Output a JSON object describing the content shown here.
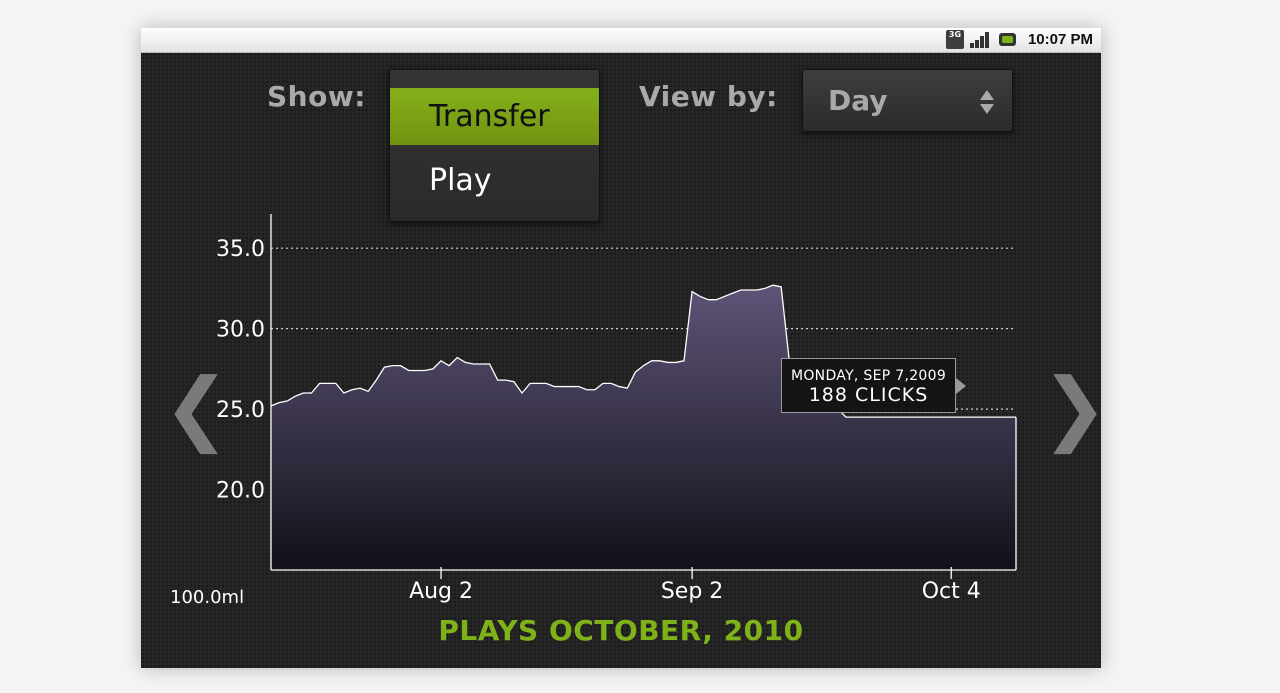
{
  "status_bar": {
    "network": "3G",
    "time": "10:07 PM"
  },
  "controls": {
    "show_label": "Show:",
    "show_options": [
      "Transfer",
      "Play"
    ],
    "show_selected": "Transfer",
    "viewby_label": "View by:",
    "viewby_value": "Day"
  },
  "navigation": {
    "prev": "❮",
    "next": "❯"
  },
  "unit_label": "100.0ml",
  "tooltip": {
    "date": "MONDAY, SEP 7,2009",
    "value": "188 CLICKS"
  },
  "colors": {
    "accent": "#7fb219",
    "selected_item": "#86b01a",
    "area_top": "#5e5478",
    "area_bottom": "#121018"
  },
  "chart_data": {
    "type": "area",
    "title": "PLAYS OCTOBER, 2010",
    "xlabel": "",
    "ylabel": "",
    "yticks": [
      "35.0",
      "30.0",
      "25.0",
      "20.0"
    ],
    "xticks": [
      "Aug 2",
      "Sep 2",
      "Oct 4"
    ],
    "ylim": [
      15,
      37
    ],
    "grid": true,
    "x": [
      "Jul 12",
      "Jul 13",
      "Jul 14",
      "Jul 15",
      "Jul 16",
      "Jul 17",
      "Jul 18",
      "Jul 19",
      "Jul 20",
      "Jul 21",
      "Jul 22",
      "Jul 23",
      "Jul 24",
      "Jul 25",
      "Jul 26",
      "Jul 27",
      "Jul 28",
      "Jul 29",
      "Jul 30",
      "Jul 31",
      "Aug 1",
      "Aug 2",
      "Aug 3",
      "Aug 4",
      "Aug 5",
      "Aug 6",
      "Aug 7",
      "Aug 8",
      "Aug 9",
      "Aug 10",
      "Aug 11",
      "Aug 12",
      "Aug 13",
      "Aug 14",
      "Aug 15",
      "Aug 16",
      "Aug 17",
      "Aug 18",
      "Aug 19",
      "Aug 20",
      "Aug 21",
      "Aug 22",
      "Aug 23",
      "Aug 24",
      "Aug 25",
      "Aug 26",
      "Aug 27",
      "Aug 28",
      "Aug 29",
      "Aug 30",
      "Aug 31",
      "Sep 1",
      "Sep 2",
      "Sep 3",
      "Sep 4",
      "Sep 5",
      "Sep 6",
      "Sep 7",
      "Sep 8",
      "Sep 9",
      "Sep 10",
      "Sep 11",
      "Sep 12",
      "Sep 13",
      "Sep 14",
      "Sep 15",
      "Sep 16",
      "Sep 17",
      "Sep 18",
      "Sep 19",
      "Sep 20",
      "Sep 21",
      "Sep 22",
      "Sep 23",
      "Sep 24",
      "Sep 25",
      "Sep 26",
      "Sep 27",
      "Sep 28",
      "Sep 29",
      "Sep 30",
      "Oct 1",
      "Oct 2",
      "Oct 3",
      "Oct 4",
      "Oct 5",
      "Oct 6",
      "Oct 7",
      "Oct 8",
      "Oct 9",
      "Oct 10",
      "Oct 11",
      "Oct 12"
    ],
    "series": [
      {
        "values": [
          25.2,
          25.4,
          25.5,
          25.8,
          26.0,
          26.0,
          26.6,
          26.6,
          26.6,
          26.0,
          26.2,
          26.3,
          26.1,
          26.8,
          27.6,
          27.7,
          27.7,
          27.4,
          27.4,
          27.4,
          27.5,
          28.0,
          27.7,
          28.2,
          27.9,
          27.8,
          27.8,
          27.8,
          26.8,
          26.8,
          26.7,
          26.0,
          26.6,
          26.6,
          26.6,
          26.4,
          26.4,
          26.4,
          26.4,
          26.2,
          26.2,
          26.6,
          26.6,
          26.4,
          26.3,
          27.3,
          27.7,
          28.0,
          28.0,
          27.9,
          27.9,
          28.0,
          32.3,
          32.0,
          31.8,
          31.8,
          32.0,
          32.2,
          32.4,
          32.4,
          32.4,
          32.5,
          32.7,
          32.6,
          28.0,
          25.9,
          25.4,
          25.7,
          25.8,
          25.6,
          25.0,
          24.5,
          24.5,
          24.5,
          24.5,
          24.5,
          24.5,
          24.5,
          24.5,
          24.5,
          24.5,
          24.5,
          24.5,
          24.5,
          24.5,
          24.5,
          24.5,
          24.5,
          24.5,
          24.5,
          24.5,
          24.5,
          24.5
        ]
      }
    ]
  }
}
